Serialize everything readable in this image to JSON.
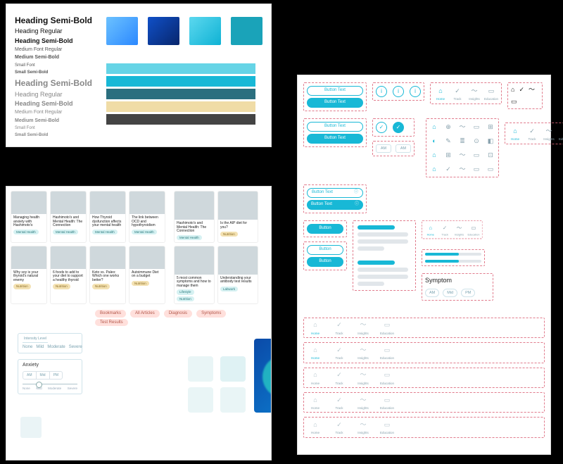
{
  "panelA": {
    "typography": {
      "t0": "Heading Semi-Bold",
      "t1": "Heading Regular",
      "t2": "Heading Semi-Bold",
      "t3": "Medium Font Regular",
      "t4": "Medium Semi-Bold",
      "t5": "Small Font",
      "t6": "Small Semi-Bold"
    },
    "paletteSwatches": [
      "#4aa9ff",
      "#0c3c9a",
      "#26c3e6",
      "#1aa3b9"
    ],
    "paletteBars": [
      "#66d4e6",
      "#18b8d6",
      "#2b6f7f",
      "#f0dca6",
      "#444444"
    ]
  },
  "panelB": {
    "cardsRow1": [
      {
        "title": "Managing health anxiety with Hashimoto's",
        "tag": "Mental Health",
        "tagKind": "teal"
      },
      {
        "title": "Hashimoto's and Mental Health: The Connection",
        "tag": "Mental Health",
        "tagKind": "teal"
      },
      {
        "title": "How Thyroid dysfunction affects your mental health",
        "tag": "Mental Health",
        "tagKind": "teal"
      },
      {
        "title": "The link between OCD and hypothyroidism",
        "tag": "Mental Health",
        "tagKind": "teal"
      }
    ],
    "cardsRow1Wide": [
      {
        "title": "Hashimoto's and Mental Health: The Connection",
        "tag": "Mental Health",
        "tagKind": "teal"
      },
      {
        "title": "Is the AIP diet for you?",
        "tag": "Nutrition",
        "tagKind": "gold"
      }
    ],
    "cardsRow2": [
      {
        "title": "Why soy is your thyroid's natural enemy",
        "tag": "Nutrition",
        "tagKind": "gold"
      },
      {
        "title": "6 foods to add to your diet to support a healthy thyroid",
        "tag": "Nutrition",
        "tagKind": "gold"
      },
      {
        "title": "Keto vs. Paleo: Which one works better?",
        "tag": "Nutrition",
        "tagKind": "gold"
      },
      {
        "title": "Autoimmune Diet on a budget",
        "tag": "Nutrition",
        "tagKind": "gold"
      }
    ],
    "cardsRow2Wide": [
      {
        "title": "5 most common symptoms and how to manage them",
        "tags": [
          "Lifestyle",
          "Nutrition"
        ],
        "tagKind": "teal"
      },
      {
        "title": "Understanding your antibody test results",
        "tag": "Labwork",
        "tagKind": "teal"
      }
    ],
    "chips": [
      "Bookmarks",
      "All Articles",
      "Diagnosis",
      "Symptoms"
    ],
    "chip2": "Test Results",
    "intensity": {
      "label": "Intensity Level",
      "options": [
        "None",
        "Mild",
        "Moderate",
        "Severe"
      ]
    },
    "anxiety": {
      "label": "Anxiety",
      "segments": [
        "AM",
        "Mid",
        "PM"
      ],
      "scale": [
        "None",
        "Mild",
        "Moderate",
        "Severe"
      ]
    }
  },
  "panelC": {
    "buttonText": "Button Text",
    "buttonShort": "Button",
    "am": "AM",
    "pm": "PM",
    "nav": [
      "Home",
      "Track",
      "Insights",
      "Education"
    ],
    "symptom": {
      "label": "Symptom",
      "opts": [
        "AM",
        "Mid",
        "PM"
      ]
    }
  }
}
